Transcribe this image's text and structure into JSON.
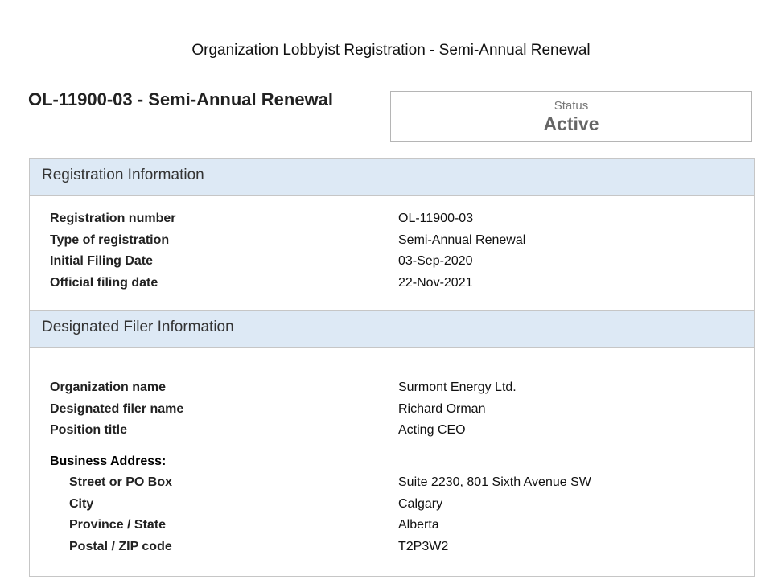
{
  "page_title": "Organization Lobbyist Registration - Semi-Annual Renewal",
  "registration_heading": "OL-11900-03 - Semi-Annual Renewal",
  "status": {
    "label": "Status",
    "value": "Active"
  },
  "registration_info": {
    "title": "Registration Information",
    "rows": [
      {
        "label": "Registration number",
        "value": "OL-11900-03"
      },
      {
        "label": "Type of registration",
        "value": "Semi-Annual Renewal"
      },
      {
        "label": "Initial Filing Date",
        "value": "03-Sep-2020"
      },
      {
        "label": "Official filing date",
        "value": "22-Nov-2021"
      }
    ]
  },
  "designated_filer": {
    "title": "Designated Filer Information",
    "rows": [
      {
        "label": "Organization name",
        "value": "Surmont Energy Ltd."
      },
      {
        "label": "Designated filer name",
        "value": "Richard Orman"
      },
      {
        "label": "Position title",
        "value": "Acting CEO"
      }
    ],
    "business_address": {
      "title": "Business Address:",
      "rows": [
        {
          "label": "Street or PO Box",
          "value": "Suite 2230, 801 Sixth Avenue SW"
        },
        {
          "label": "City",
          "value": "Calgary"
        },
        {
          "label": "Province / State",
          "value": "Alberta"
        },
        {
          "label": "Postal / ZIP code",
          "value": "T2P3W2"
        }
      ]
    }
  }
}
